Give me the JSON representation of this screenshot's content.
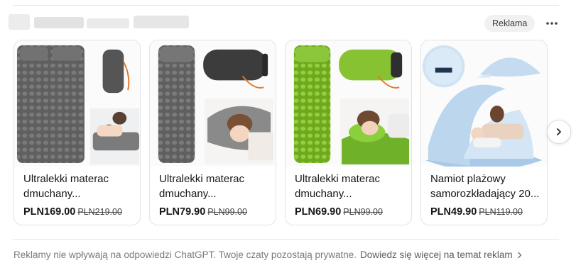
{
  "header": {
    "ad_badge": "Reklama",
    "more_icon": "ellipsis-horizontal-icon"
  },
  "products": [
    {
      "title_line1": "Ultralekki materac",
      "title_line2": "dmuchany...",
      "price": "PLN169.00",
      "old_price": "PLN219.00",
      "accent": "#6b6b6b"
    },
    {
      "title_line1": "Ultralekki materac",
      "title_line2": "dmuchany...",
      "price": "PLN79.90",
      "old_price": "PLN99.00",
      "accent": "#6b6b6b"
    },
    {
      "title_line1": "Ultralekki materac",
      "title_line2": "dmuchany...",
      "price": "PLN69.90",
      "old_price": "PLN99.00",
      "accent": "#86c232"
    },
    {
      "title_line1": "Namiot plażowy",
      "title_line2": "samorozkładający 20...",
      "price": "PLN49.90",
      "old_price": "PLN119.00",
      "accent": "#bcd7ef"
    }
  ],
  "carousel": {
    "next_icon": "chevron-right-icon"
  },
  "footer": {
    "text": "Reklamy nie wpływają na odpowiedzi ChatGPT. Twoje czaty pozostają prywatne.",
    "link": "Dowiedz się więcej na temat reklam",
    "link_icon": "chevron-right-icon"
  }
}
